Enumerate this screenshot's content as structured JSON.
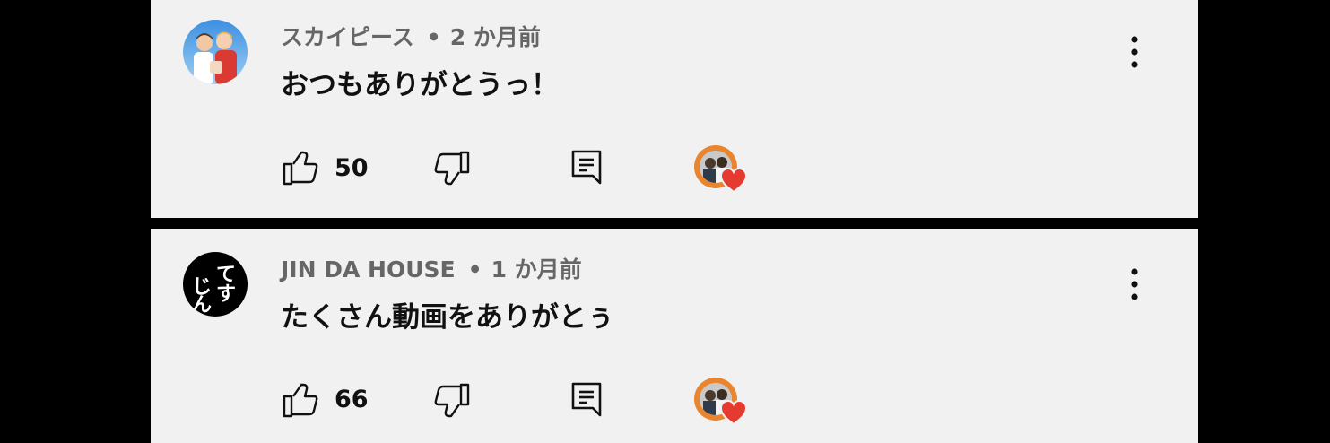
{
  "comments": [
    {
      "author": "スカイピース",
      "separator": "•",
      "time": "2 か月前",
      "text": "おつもありがとうっ！",
      "likes": "50",
      "avatar_icon": "person-avatar-photo",
      "more_icon": "more-vertical-icon",
      "hearted_icon": "creator-heart-icon"
    },
    {
      "author": "JIN DA HOUSE",
      "separator": "•",
      "time": "1 か月前",
      "text": "たくさん動画をありがとぅ",
      "likes": "66",
      "avatar_icon": "logo-avatar",
      "avatar_logo_text": "じてんす",
      "more_icon": "more-vertical-icon",
      "hearted_icon": "creator-heart-icon"
    }
  ],
  "icons": {
    "like": "thumbs-up-icon",
    "dislike": "thumbs-down-icon",
    "reply": "reply-comment-icon"
  },
  "colors": {
    "card_background": "#f1f1f1",
    "page_background": "#000000",
    "heart": "#e53a2f",
    "creator_ring": "#e9852f",
    "meta_text": "#666666",
    "body_text": "#111111"
  }
}
